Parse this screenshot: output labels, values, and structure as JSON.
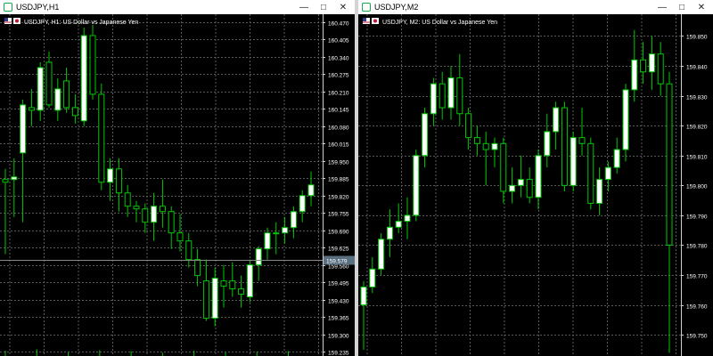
{
  "windows": [
    {
      "title": "USDJPY,H1",
      "chart_label": "USDJPY, H1:  US Dollar vs Japanese Yen",
      "window_buttons": {
        "minimize": "—",
        "maximize": "□",
        "close": "✕"
      },
      "colors": {
        "background": "#000000",
        "grid": "#5a5a5a",
        "bull": "#ffffff",
        "bear": "#000000",
        "wick": "#00c800",
        "axis_text": "#ffffff",
        "price_tag": "#5a6f80"
      },
      "price_tag": "159.579",
      "chart_data": {
        "type": "candlestick",
        "symbol": "USDJPY",
        "timeframe": "H1",
        "y_axis_ticks": [
          160.47,
          160.405,
          160.34,
          160.275,
          160.21,
          160.145,
          160.08,
          160.015,
          159.95,
          159.885,
          159.82,
          159.755,
          159.69,
          159.625,
          159.56,
          159.495,
          159.43,
          159.365,
          159.3,
          159.235
        ],
        "ylim": [
          159.225,
          160.48
        ],
        "current_price": 159.579,
        "candles": [
          {
            "o": 159.88,
            "h": 159.92,
            "l": 159.6,
            "c": 159.87
          },
          {
            "o": 159.88,
            "h": 159.96,
            "l": 159.74,
            "c": 159.89
          },
          {
            "o": 159.98,
            "h": 160.18,
            "l": 159.72,
            "c": 160.16
          },
          {
            "o": 160.15,
            "h": 160.22,
            "l": 160.08,
            "c": 160.14
          },
          {
            "o": 160.14,
            "h": 160.32,
            "l": 160.1,
            "c": 160.3
          },
          {
            "o": 160.32,
            "h": 160.36,
            "l": 160.15,
            "c": 160.16
          },
          {
            "o": 160.14,
            "h": 160.26,
            "l": 160.1,
            "c": 160.22
          },
          {
            "o": 160.25,
            "h": 160.3,
            "l": 160.13,
            "c": 160.15
          },
          {
            "o": 160.15,
            "h": 160.2,
            "l": 160.09,
            "c": 160.12
          },
          {
            "o": 160.1,
            "h": 160.45,
            "l": 160.08,
            "c": 160.42
          },
          {
            "o": 160.42,
            "h": 160.46,
            "l": 160.18,
            "c": 160.2
          },
          {
            "o": 160.2,
            "h": 160.24,
            "l": 159.84,
            "c": 159.87
          },
          {
            "o": 159.87,
            "h": 159.96,
            "l": 159.8,
            "c": 159.92
          },
          {
            "o": 159.92,
            "h": 159.96,
            "l": 159.76,
            "c": 159.83
          },
          {
            "o": 159.83,
            "h": 159.86,
            "l": 159.74,
            "c": 159.78
          },
          {
            "o": 159.78,
            "h": 159.8,
            "l": 159.72,
            "c": 159.77
          },
          {
            "o": 159.77,
            "h": 159.79,
            "l": 159.68,
            "c": 159.72
          },
          {
            "o": 159.72,
            "h": 159.83,
            "l": 159.65,
            "c": 159.78
          },
          {
            "o": 159.78,
            "h": 159.88,
            "l": 159.7,
            "c": 159.76
          },
          {
            "o": 159.76,
            "h": 159.78,
            "l": 159.62,
            "c": 159.68
          },
          {
            "o": 159.68,
            "h": 159.75,
            "l": 159.61,
            "c": 159.65
          },
          {
            "o": 159.65,
            "h": 159.68,
            "l": 159.55,
            "c": 159.58
          },
          {
            "o": 159.58,
            "h": 159.62,
            "l": 159.48,
            "c": 159.52
          },
          {
            "o": 159.5,
            "h": 159.58,
            "l": 159.35,
            "c": 159.36
          },
          {
            "o": 159.36,
            "h": 159.55,
            "l": 159.33,
            "c": 159.51
          },
          {
            "o": 159.5,
            "h": 159.56,
            "l": 159.4,
            "c": 159.48
          },
          {
            "o": 159.5,
            "h": 159.57,
            "l": 159.44,
            "c": 159.47
          },
          {
            "o": 159.47,
            "h": 159.52,
            "l": 159.4,
            "c": 159.45
          },
          {
            "o": 159.44,
            "h": 159.58,
            "l": 159.42,
            "c": 159.56
          },
          {
            "o": 159.56,
            "h": 159.63,
            "l": 159.5,
            "c": 159.62
          },
          {
            "o": 159.62,
            "h": 159.7,
            "l": 159.58,
            "c": 159.68
          },
          {
            "o": 159.68,
            "h": 159.72,
            "l": 159.6,
            "c": 159.68
          },
          {
            "o": 159.68,
            "h": 159.74,
            "l": 159.64,
            "c": 159.7
          },
          {
            "o": 159.7,
            "h": 159.78,
            "l": 159.66,
            "c": 159.76
          },
          {
            "o": 159.76,
            "h": 159.84,
            "l": 159.72,
            "c": 159.82
          },
          {
            "o": 159.82,
            "h": 159.91,
            "l": 159.78,
            "c": 159.86
          }
        ],
        "volume_bars": [
          0.02,
          0.025,
          0.015,
          0.022,
          0.018,
          0.012,
          0.02,
          0.014,
          0.016,
          0.018
        ]
      }
    },
    {
      "title": "USDJPY,M2",
      "chart_label": "USDJPY, M2:  US Dollar vs Japanese Yen",
      "window_buttons": {
        "minimize": "—",
        "maximize": "□",
        "close": "✕"
      },
      "colors": {
        "background": "#000000",
        "grid": "#5a5a5a",
        "bull": "#ffffff",
        "bear": "#000000",
        "wick": "#00c800",
        "axis_text": "#ffffff"
      },
      "chart_data": {
        "type": "candlestick",
        "symbol": "USDJPY",
        "timeframe": "M2",
        "y_axis_ticks": [
          159.85,
          159.84,
          159.83,
          159.82,
          159.81,
          159.8,
          159.79,
          159.78,
          159.77,
          159.76,
          159.75
        ],
        "ylim": [
          159.7435,
          159.8555
        ],
        "candles": [
          {
            "o": 159.76,
            "h": 159.768,
            "l": 159.745,
            "c": 159.766
          },
          {
            "o": 159.766,
            "h": 159.776,
            "l": 159.764,
            "c": 159.772
          },
          {
            "o": 159.772,
            "h": 159.784,
            "l": 159.77,
            "c": 159.782
          },
          {
            "o": 159.782,
            "h": 159.792,
            "l": 159.776,
            "c": 159.786
          },
          {
            "o": 159.786,
            "h": 159.794,
            "l": 159.784,
            "c": 159.788
          },
          {
            "o": 159.788,
            "h": 159.796,
            "l": 159.782,
            "c": 159.79
          },
          {
            "o": 159.79,
            "h": 159.812,
            "l": 159.788,
            "c": 159.81
          },
          {
            "o": 159.81,
            "h": 159.826,
            "l": 159.806,
            "c": 159.824
          },
          {
            "o": 159.824,
            "h": 159.836,
            "l": 159.82,
            "c": 159.834
          },
          {
            "o": 159.834,
            "h": 159.838,
            "l": 159.822,
            "c": 159.826
          },
          {
            "o": 159.826,
            "h": 159.84,
            "l": 159.822,
            "c": 159.836
          },
          {
            "o": 159.836,
            "h": 159.844,
            "l": 159.82,
            "c": 159.824
          },
          {
            "o": 159.824,
            "h": 159.826,
            "l": 159.812,
            "c": 159.816
          },
          {
            "o": 159.816,
            "h": 159.82,
            "l": 159.81,
            "c": 159.814
          },
          {
            "o": 159.814,
            "h": 159.818,
            "l": 159.8,
            "c": 159.812
          },
          {
            "o": 159.812,
            "h": 159.816,
            "l": 159.806,
            "c": 159.814
          },
          {
            "o": 159.814,
            "h": 159.816,
            "l": 159.794,
            "c": 159.798
          },
          {
            "o": 159.798,
            "h": 159.806,
            "l": 159.794,
            "c": 159.8
          },
          {
            "o": 159.8,
            "h": 159.81,
            "l": 159.796,
            "c": 159.802
          },
          {
            "o": 159.802,
            "h": 159.806,
            "l": 159.794,
            "c": 159.796
          },
          {
            "o": 159.796,
            "h": 159.812,
            "l": 159.792,
            "c": 159.81
          },
          {
            "o": 159.81,
            "h": 159.824,
            "l": 159.806,
            "c": 159.818
          },
          {
            "o": 159.818,
            "h": 159.828,
            "l": 159.812,
            "c": 159.826
          },
          {
            "o": 159.826,
            "h": 159.828,
            "l": 159.798,
            "c": 159.8
          },
          {
            "o": 159.8,
            "h": 159.818,
            "l": 159.798,
            "c": 159.816
          },
          {
            "o": 159.816,
            "h": 159.826,
            "l": 159.81,
            "c": 159.814
          },
          {
            "o": 159.814,
            "h": 159.816,
            "l": 159.792,
            "c": 159.794
          },
          {
            "o": 159.794,
            "h": 159.806,
            "l": 159.79,
            "c": 159.802
          },
          {
            "o": 159.802,
            "h": 159.808,
            "l": 159.798,
            "c": 159.806
          },
          {
            "o": 159.806,
            "h": 159.816,
            "l": 159.804,
            "c": 159.812
          },
          {
            "o": 159.812,
            "h": 159.834,
            "l": 159.808,
            "c": 159.832
          },
          {
            "o": 159.832,
            "h": 159.852,
            "l": 159.828,
            "c": 159.842
          },
          {
            "o": 159.842,
            "h": 159.848,
            "l": 159.834,
            "c": 159.838
          },
          {
            "o": 159.838,
            "h": 159.85,
            "l": 159.832,
            "c": 159.844
          },
          {
            "o": 159.844,
            "h": 159.848,
            "l": 159.83,
            "c": 159.834
          },
          {
            "o": 159.834,
            "h": 159.838,
            "l": 159.744,
            "c": 159.78
          }
        ]
      }
    }
  ]
}
